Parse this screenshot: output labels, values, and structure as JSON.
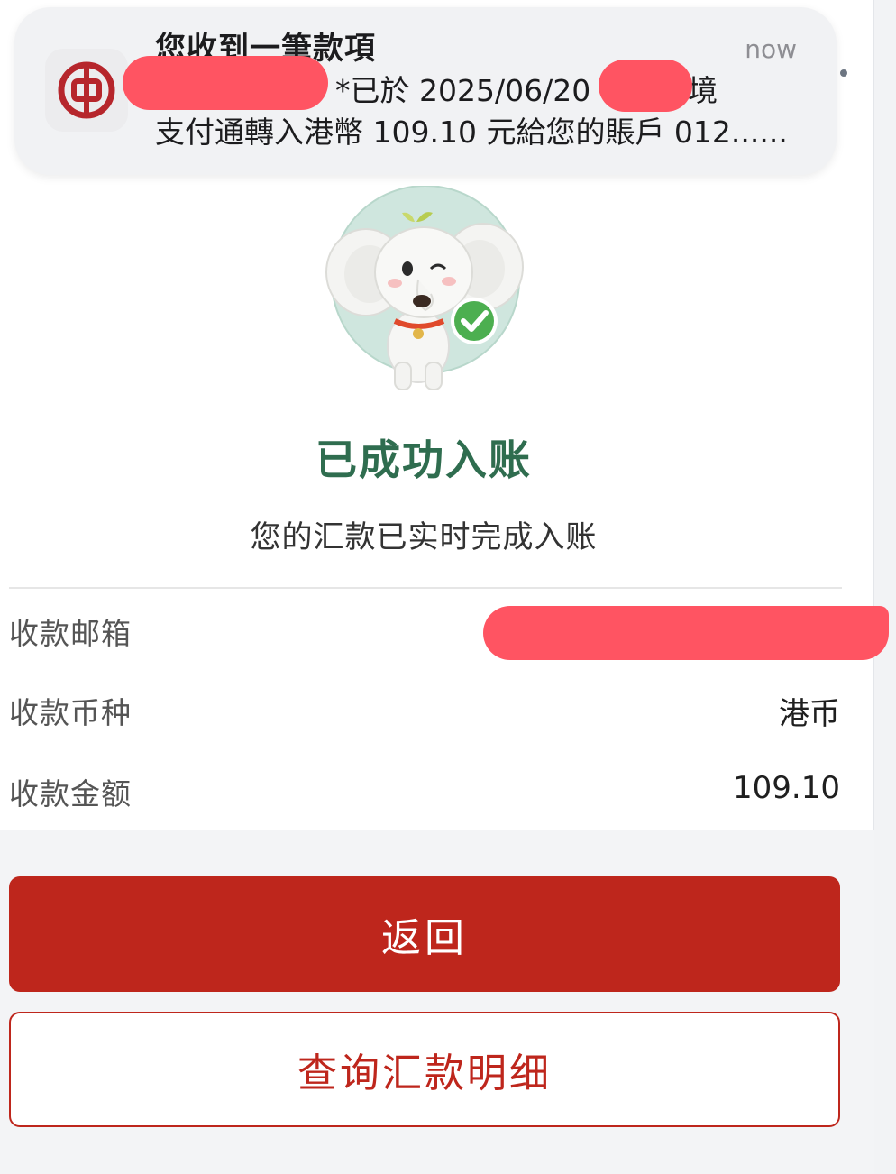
{
  "notification": {
    "app_icon": "bank-of-china-logo-icon",
    "title": "您收到一筆款項",
    "time": "now",
    "body_line1": "*已於 2025/06/20 1 經跨境",
    "body_line2": "支付通轉入港幣 109.10 元給您的賬戶 012......"
  },
  "result": {
    "illustration": "elephant-mascot-with-checkmark",
    "title": "已成功入账",
    "subtitle": "您的汇款已实时完成入账"
  },
  "details": [
    {
      "label": "收款邮箱",
      "value": ""
    },
    {
      "label": "收款币种",
      "value": "港币"
    },
    {
      "label": "收款金额",
      "value": "109.10"
    }
  ],
  "buttons": {
    "back": "返回",
    "query": "查询汇款明细"
  },
  "colors": {
    "brand_red": "#be261c",
    "success_green": "#2f6d4f",
    "redaction": "#ff5462"
  }
}
